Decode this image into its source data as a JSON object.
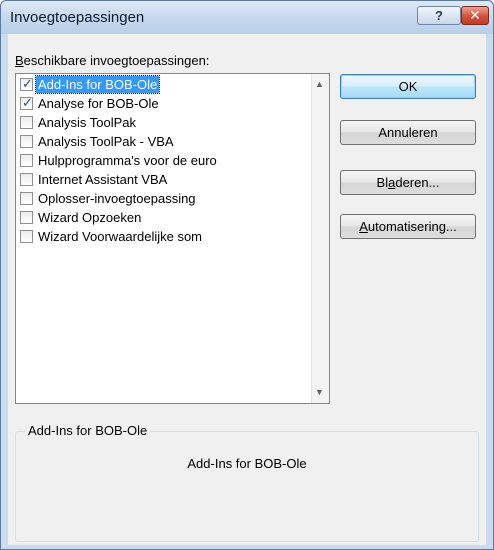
{
  "window": {
    "title": "Invoegtoepassingen",
    "help_glyph": "?",
    "close_glyph": "✕"
  },
  "addins": {
    "label_underlined": "B",
    "label_rest": "eschikbare invoegtoepassingen:",
    "items": [
      {
        "label": "Add-Ins for BOB-Ole",
        "checked": true,
        "selected": true
      },
      {
        "label": "Analyse for BOB-Ole",
        "checked": true,
        "selected": false
      },
      {
        "label": "Analysis ToolPak",
        "checked": false,
        "selected": false
      },
      {
        "label": "Analysis ToolPak - VBA",
        "checked": false,
        "selected": false
      },
      {
        "label": "Hulpprogramma's voor de euro",
        "checked": false,
        "selected": false
      },
      {
        "label": "Internet Assistant VBA",
        "checked": false,
        "selected": false
      },
      {
        "label": "Oplosser-invoegtoepassing",
        "checked": false,
        "selected": false
      },
      {
        "label": "Wizard Opzoeken",
        "checked": false,
        "selected": false
      },
      {
        "label": "Wizard Voorwaardelijke som",
        "checked": false,
        "selected": false
      }
    ]
  },
  "buttons": {
    "ok": "OK",
    "cancel": "Annuleren",
    "browse_pre": "Bl",
    "browse_ul": "a",
    "browse_post": "deren...",
    "automation_ul": "A",
    "automation_rest": "utomatisering..."
  },
  "description": {
    "caption": "Add-Ins for BOB-Ole",
    "text": "Add-Ins for BOB-Ole"
  },
  "colors": {
    "selection": "#3399ff",
    "close_button": "#d2523c"
  }
}
